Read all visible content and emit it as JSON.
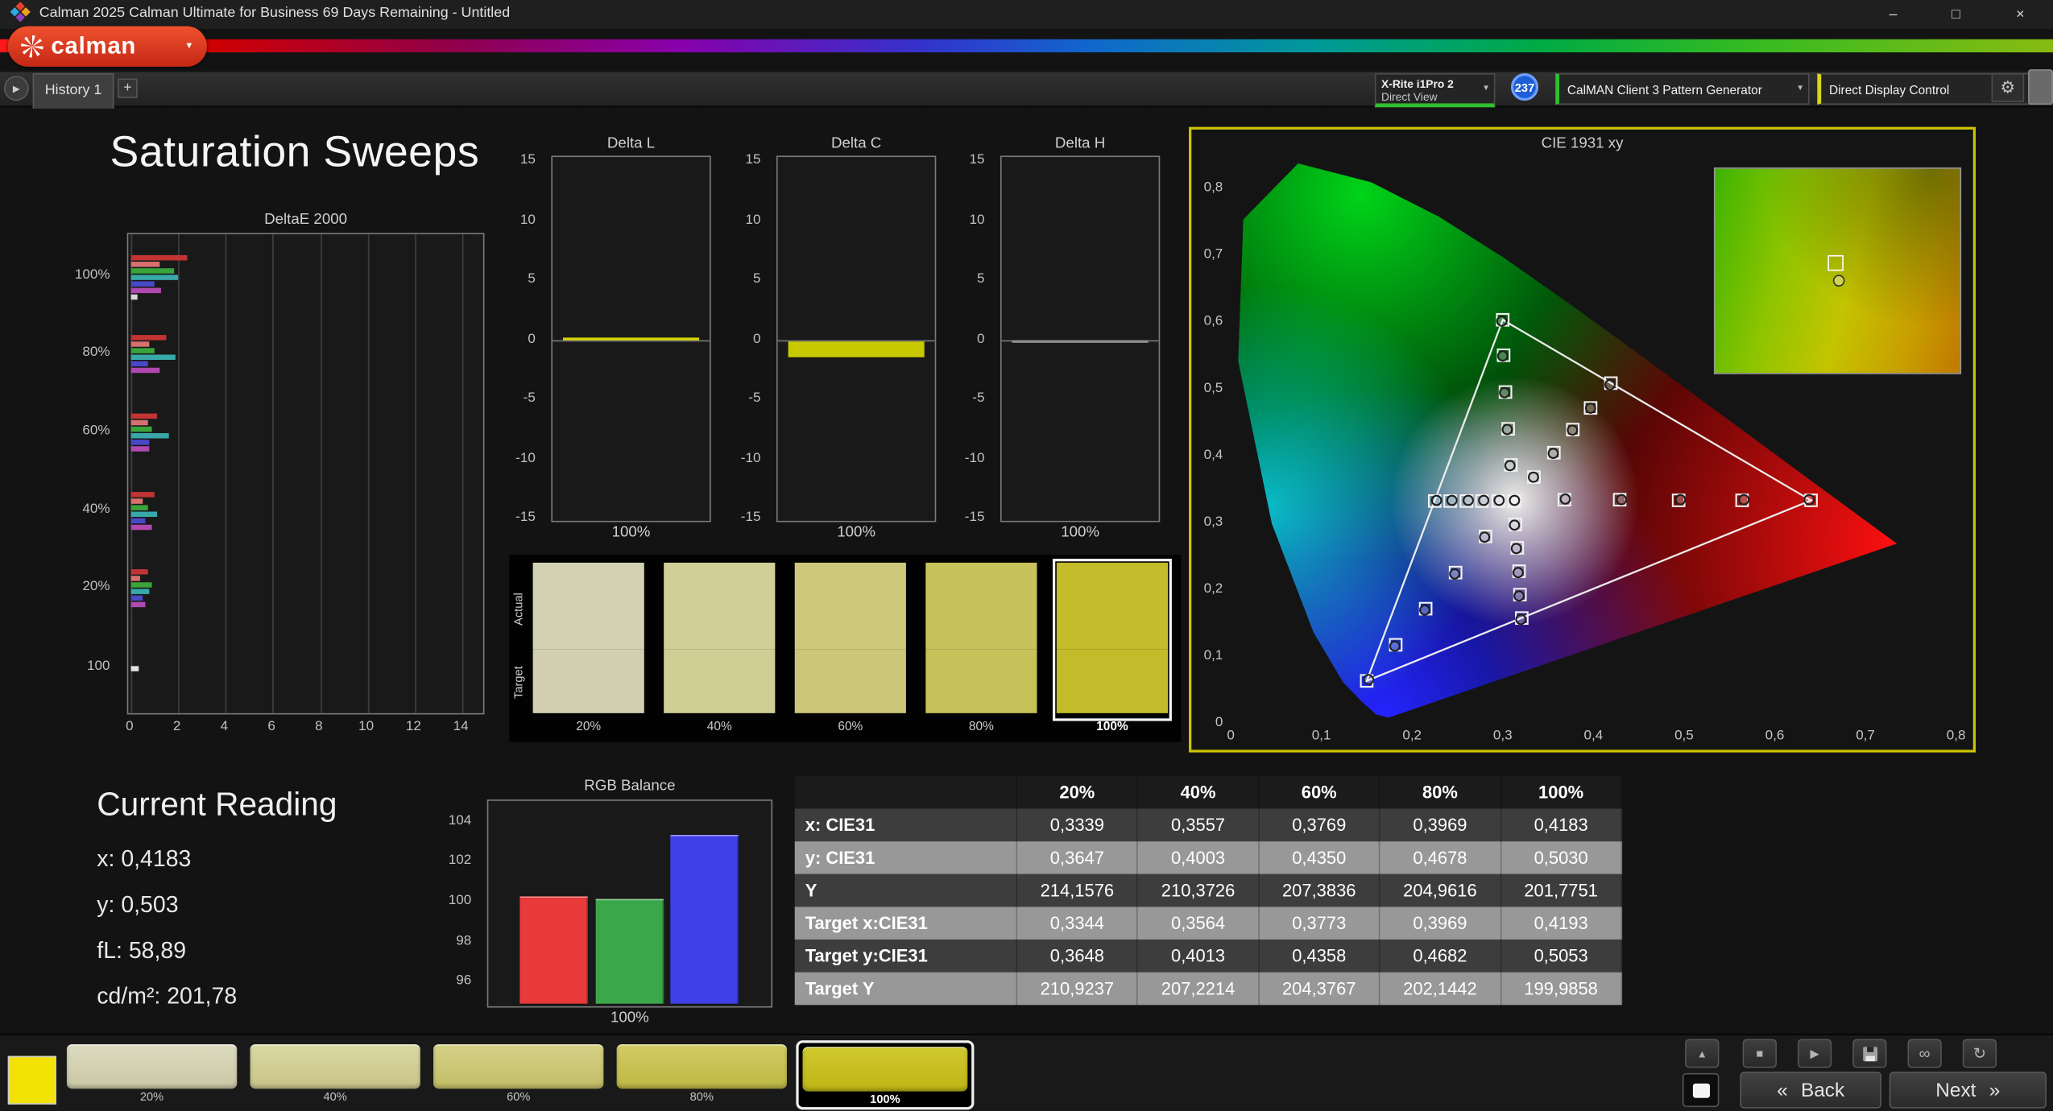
{
  "window": {
    "title": "Calman 2025 Calman Ultimate for Business 69 Days Remaining  - Untitled"
  },
  "icons": {
    "chevron_down": "▼",
    "play": "▶",
    "history": "▶",
    "stop": "■",
    "infinity": "∞",
    "refresh": "↻",
    "chevron_up": "▲",
    "back": "«",
    "forward": "»",
    "gear": "⚙",
    "plus": "+",
    "minimize": "–",
    "restore": "□",
    "close": "×"
  },
  "logo": {
    "text": "calman"
  },
  "tab_bar": {
    "active_tab": "History 1",
    "add_tab": "+"
  },
  "device_bar": {
    "meter": {
      "line1": "X-Rite i1Pro 2",
      "line2": "Direct View",
      "accent": "#2fbf2f"
    },
    "badge": "237",
    "pattern_generator": {
      "label": "CalMAN Client 3 Pattern Generator",
      "accent": "#2fbf2f"
    },
    "display_control": {
      "label": "Direct Display Control",
      "accent": "#d8d813"
    }
  },
  "page": {
    "heading": "Saturation Sweeps"
  },
  "current_reading": {
    "title": "Current Reading",
    "lines": [
      "x: 0,4183",
      "y: 0,503",
      "fL: 58,89",
      "cd/m²: 201,78"
    ]
  },
  "swatch_panel": {
    "row_labels": [
      "Actual",
      "Target"
    ],
    "selected_index": 4,
    "columns": [
      {
        "label": "20%",
        "actual": "#d3d1b4",
        "target": "#d2d0b1"
      },
      {
        "label": "40%",
        "actual": "#d1ce97",
        "target": "#d0cd95"
      },
      {
        "label": "60%",
        "actual": "#cdc87a",
        "target": "#ccc778"
      },
      {
        "label": "80%",
        "actual": "#c8c25c",
        "target": "#c7c15a"
      },
      {
        "label": "100%",
        "actual": "#c4bc2b",
        "target": "#c3bb29"
      }
    ]
  },
  "results_table": {
    "header": [
      "",
      "20%",
      "40%",
      "60%",
      "80%",
      "100%"
    ],
    "rows": [
      {
        "label": "x: CIE31",
        "values": [
          "0,3339",
          "0,3557",
          "0,3769",
          "0,3969",
          "0,4183"
        ]
      },
      {
        "label": "y: CIE31",
        "values": [
          "0,3647",
          "0,4003",
          "0,4350",
          "0,4678",
          "0,5030"
        ]
      },
      {
        "label": "Y",
        "values": [
          "214,1576",
          "210,3726",
          "207,3836",
          "204,9616",
          "201,7751"
        ]
      },
      {
        "label": "Target x:CIE31",
        "values": [
          "0,3344",
          "0,3564",
          "0,3773",
          "0,3969",
          "0,4193"
        ]
      },
      {
        "label": "Target y:CIE31",
        "values": [
          "0,3648",
          "0,4013",
          "0,4358",
          "0,4682",
          "0,5053"
        ]
      },
      {
        "label": "Target Y",
        "values": [
          "210,9237",
          "207,2214",
          "204,3767",
          "202,1442",
          "199,9858"
        ]
      }
    ]
  },
  "bottom_bar": {
    "selected_index": 4,
    "back_label": "Back",
    "next_label": "Next",
    "swatches": [
      {
        "label": "20%",
        "top": "#dedcc0",
        "bottom": "#c9c7a6"
      },
      {
        "label": "40%",
        "top": "#dbd8a4",
        "bottom": "#c8c488"
      },
      {
        "label": "60%",
        "top": "#d6d287",
        "bottom": "#c2bd66"
      },
      {
        "label": "80%",
        "top": "#d2cc66",
        "bottom": "#beb844"
      },
      {
        "label": "100%",
        "top": "#d0c92e",
        "bottom": "#beb516"
      }
    ]
  },
  "chart_data": [
    {
      "id": "deltae2000",
      "type": "bar",
      "orientation": "horizontal",
      "title": "DeltaE 2000",
      "xlim": [
        0,
        14
      ],
      "xticks": [
        0,
        2,
        4,
        6,
        8,
        10,
        12,
        14
      ],
      "groups": [
        {
          "category": "100%",
          "bars": [
            {
              "v": 2.4,
              "color": "#c23434"
            },
            {
              "v": 1.2,
              "color": "#d87070"
            },
            {
              "v": 1.8,
              "color": "#3aa43a"
            },
            {
              "v": 2.0,
              "color": "#38a8a8"
            },
            {
              "v": 1.0,
              "color": "#4848c8"
            },
            {
              "v": 1.3,
              "color": "#b048b0"
            },
            {
              "v": 0.25,
              "color": "#d8d8d8"
            }
          ]
        },
        {
          "category": "80%",
          "bars": [
            {
              "v": 1.5,
              "color": "#c23434"
            },
            {
              "v": 0.8,
              "color": "#d87070"
            },
            {
              "v": 1.0,
              "color": "#3aa43a"
            },
            {
              "v": 1.9,
              "color": "#38a8a8"
            },
            {
              "v": 0.7,
              "color": "#4848c8"
            },
            {
              "v": 1.2,
              "color": "#b048b0"
            }
          ]
        },
        {
          "category": "60%",
          "bars": [
            {
              "v": 1.1,
              "color": "#c23434"
            },
            {
              "v": 0.7,
              "color": "#d87070"
            },
            {
              "v": 0.9,
              "color": "#3aa43a"
            },
            {
              "v": 1.6,
              "color": "#38a8a8"
            },
            {
              "v": 0.8,
              "color": "#4848c8"
            },
            {
              "v": 0.8,
              "color": "#b048b0"
            }
          ]
        },
        {
          "category": "40%",
          "bars": [
            {
              "v": 1.0,
              "color": "#c23434"
            },
            {
              "v": 0.5,
              "color": "#d87070"
            },
            {
              "v": 0.7,
              "color": "#3aa43a"
            },
            {
              "v": 1.1,
              "color": "#38a8a8"
            },
            {
              "v": 0.6,
              "color": "#4848c8"
            },
            {
              "v": 0.9,
              "color": "#b048b0"
            }
          ]
        },
        {
          "category": "20%",
          "bars": [
            {
              "v": 0.7,
              "color": "#c23434"
            },
            {
              "v": 0.4,
              "color": "#d87070"
            },
            {
              "v": 0.9,
              "color": "#3aa43a"
            },
            {
              "v": 0.8,
              "color": "#38a8a8"
            },
            {
              "v": 0.5,
              "color": "#4848c8"
            },
            {
              "v": 0.6,
              "color": "#b048b0"
            }
          ]
        },
        {
          "category": "100",
          "bars": [
            {
              "v": 0.35,
              "color": "#e0e0e0"
            }
          ]
        }
      ]
    },
    {
      "id": "delta_l",
      "type": "bar",
      "title": "Delta L",
      "ylim": [
        -15,
        15
      ],
      "yticks": [
        15,
        10,
        5,
        0,
        -5,
        -10,
        -15
      ],
      "xlabel": "100%",
      "value": 0.3,
      "color": "#d8d800"
    },
    {
      "id": "delta_c",
      "type": "bar",
      "title": "Delta C",
      "ylim": [
        -15,
        15
      ],
      "yticks": [
        15,
        10,
        5,
        0,
        -5,
        -10,
        -15
      ],
      "xlabel": "100%",
      "value": -1.3,
      "color": "#c9c900"
    },
    {
      "id": "delta_h",
      "type": "bar",
      "title": "Delta H",
      "ylim": [
        -15,
        15
      ],
      "yticks": [
        15,
        10,
        5,
        0,
        -5,
        -10,
        -15
      ],
      "xlabel": "100%",
      "value": 0,
      "color": "#909090"
    },
    {
      "id": "rgb_balance",
      "type": "bar",
      "title": "RGB Balance",
      "xlabel": "100%",
      "categories": [
        "Red",
        "Green",
        "Blue"
      ],
      "values": [
        100.3,
        100.2,
        103.4
      ],
      "colors": [
        "#e83a3a",
        "#3aa84a",
        "#4040e8"
      ],
      "yticks": [
        104,
        102,
        100,
        98,
        96
      ],
      "ylim": [
        94.8,
        105.5
      ]
    },
    {
      "id": "cie1931",
      "type": "scatter",
      "title": "CIE 1931 xy",
      "xlabel_ticks": [
        "0",
        "0,1",
        "0,2",
        "0,3",
        "0,4",
        "0,5",
        "0,6",
        "0,7",
        "0,8"
      ],
      "ylabel_ticks": [
        "0",
        "0,1",
        "0,2",
        "0,3",
        "0,4",
        "0,5",
        "0,6",
        "0,7",
        "0,8"
      ],
      "gamut_triangle": [
        [
          0.64,
          0.33
        ],
        [
          0.3,
          0.6
        ],
        [
          0.15,
          0.06
        ]
      ],
      "targets": [
        [
          0.368,
          0.331
        ],
        [
          0.429,
          0.331
        ],
        [
          0.494,
          0.33
        ],
        [
          0.564,
          0.33
        ],
        [
          0.64,
          0.33
        ],
        [
          0.309,
          0.383
        ],
        [
          0.306,
          0.437
        ],
        [
          0.303,
          0.492
        ],
        [
          0.301,
          0.547
        ],
        [
          0.3,
          0.6
        ],
        [
          0.281,
          0.276
        ],
        [
          0.248,
          0.222
        ],
        [
          0.215,
          0.168
        ],
        [
          0.182,
          0.114
        ],
        [
          0.15,
          0.06
        ],
        [
          0.295,
          0.329
        ],
        [
          0.277,
          0.329
        ],
        [
          0.26,
          0.329
        ],
        [
          0.242,
          0.329
        ],
        [
          0.225,
          0.329
        ],
        [
          0.314,
          0.294
        ],
        [
          0.316,
          0.259
        ],
        [
          0.318,
          0.224
        ],
        [
          0.319,
          0.189
        ],
        [
          0.321,
          0.154
        ],
        [
          0.3344,
          0.3648
        ],
        [
          0.3564,
          0.4013
        ],
        [
          0.3773,
          0.4358
        ],
        [
          0.3969,
          0.4682
        ],
        [
          0.4193,
          0.5053
        ],
        [
          0.3127,
          0.329
        ]
      ],
      "measured": [
        [
          0.296,
          0.33
        ],
        [
          0.279,
          0.33
        ],
        [
          0.262,
          0.33
        ],
        [
          0.244,
          0.33
        ],
        [
          0.227,
          0.33
        ],
        [
          0.308,
          0.382
        ],
        [
          0.305,
          0.436
        ],
        [
          0.302,
          0.491
        ],
        [
          0.3,
          0.546
        ],
        [
          0.299,
          0.598
        ],
        [
          0.313,
          0.293
        ],
        [
          0.315,
          0.258
        ],
        [
          0.317,
          0.222
        ],
        [
          0.318,
          0.187
        ],
        [
          0.32,
          0.152
        ],
        [
          0.3339,
          0.3647
        ],
        [
          0.3557,
          0.4003
        ],
        [
          0.3769,
          0.435
        ],
        [
          0.3969,
          0.4678
        ],
        [
          0.4183,
          0.503
        ],
        [
          0.369,
          0.332
        ],
        [
          0.431,
          0.331
        ],
        [
          0.496,
          0.331
        ],
        [
          0.566,
          0.331
        ],
        [
          0.638,
          0.331
        ],
        [
          0.28,
          0.275
        ],
        [
          0.247,
          0.22
        ],
        [
          0.214,
          0.166
        ],
        [
          0.181,
          0.112
        ],
        [
          0.152,
          0.062
        ],
        [
          0.313,
          0.33
        ]
      ]
    }
  ]
}
